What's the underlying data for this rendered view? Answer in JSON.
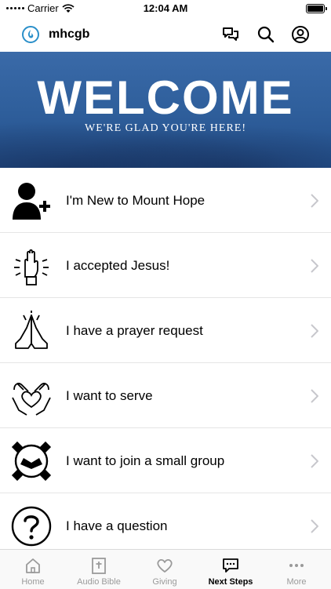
{
  "status_bar": {
    "carrier": "Carrier",
    "time": "12:04 AM"
  },
  "header": {
    "app_title": "mhcgb",
    "icons": [
      "chat-icon",
      "search-icon",
      "profile-icon"
    ]
  },
  "banner": {
    "title": "WELCOME",
    "subtitle": "WE'RE GLAD YOU'RE HERE!"
  },
  "list": {
    "items": [
      {
        "label": "I'm New to Mount Hope",
        "icon": "new-person-icon"
      },
      {
        "label": "I accepted Jesus!",
        "icon": "raised-hand-icon"
      },
      {
        "label": "I have a prayer request",
        "icon": "praying-hands-icon"
      },
      {
        "label": "I want to serve",
        "icon": "heart-hands-icon"
      },
      {
        "label": "I want to join a small group",
        "icon": "group-hands-icon"
      },
      {
        "label": "I have a question",
        "icon": "question-icon"
      }
    ]
  },
  "tab_bar": {
    "tabs": [
      {
        "label": "Home",
        "icon": "home-icon",
        "active": false
      },
      {
        "label": "Audio Bible",
        "icon": "bible-icon",
        "active": false
      },
      {
        "label": "Giving",
        "icon": "heart-icon",
        "active": false
      },
      {
        "label": "Next Steps",
        "icon": "chat-icon",
        "active": true
      },
      {
        "label": "More",
        "icon": "more-icon",
        "active": false
      }
    ]
  },
  "colors": {
    "accent": "#2a8fc9",
    "banner": "#2f5f9c"
  }
}
